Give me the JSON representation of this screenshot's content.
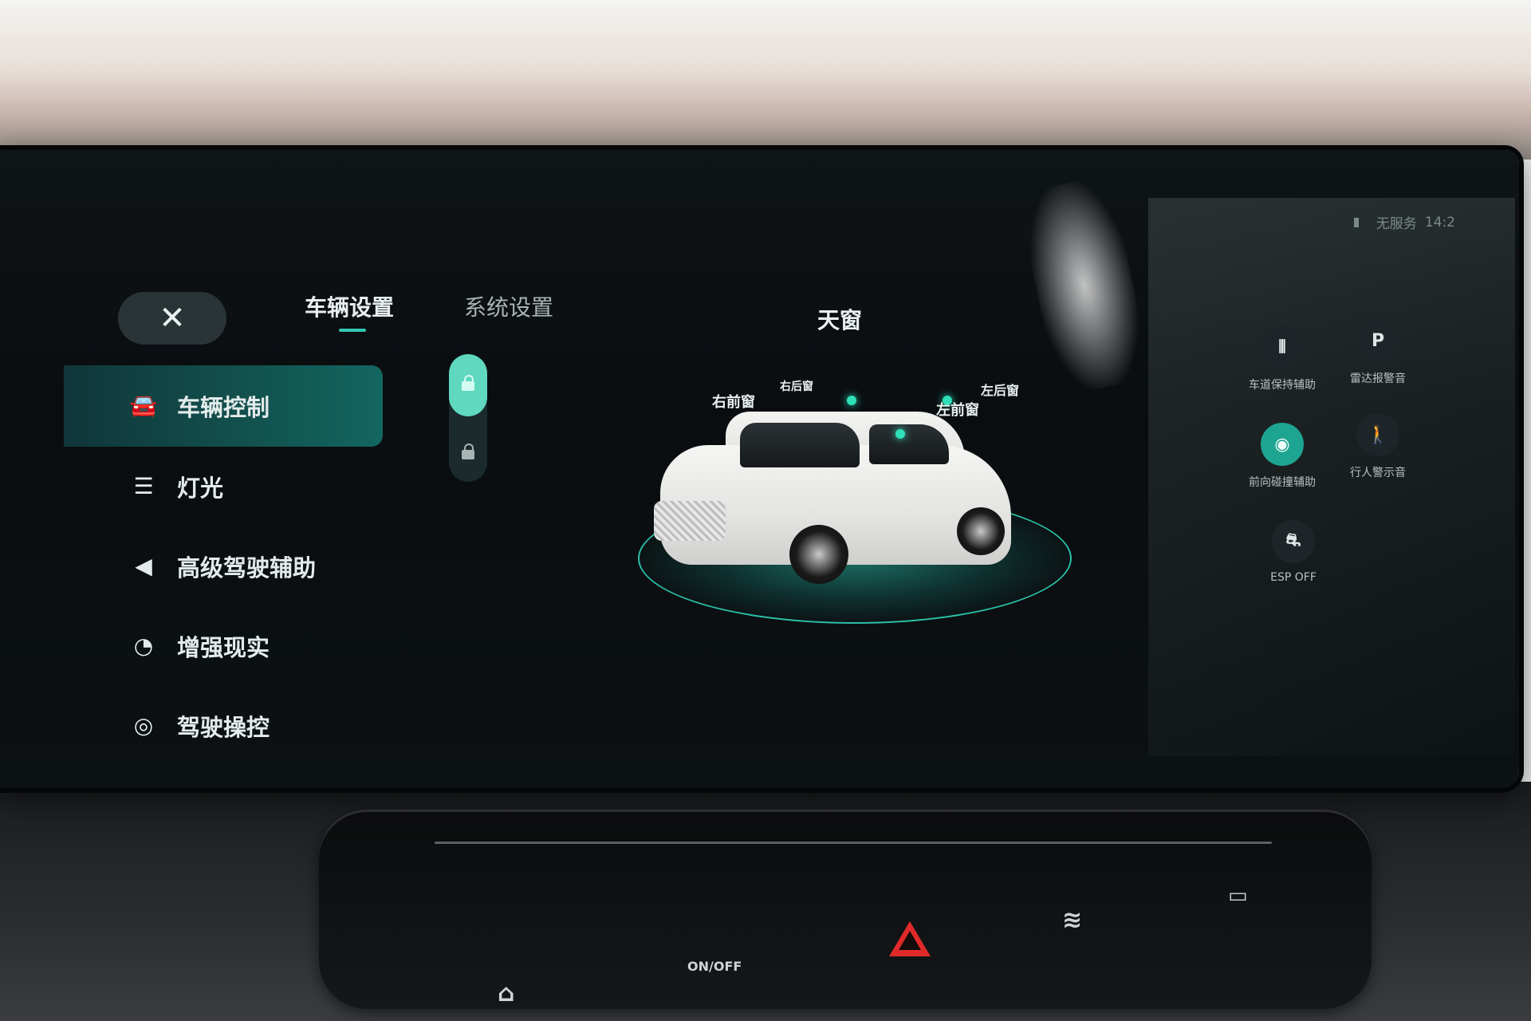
{
  "status_bar": {
    "network": "无服务",
    "time": "14:2"
  },
  "top_tabs": {
    "close_glyph": "✕",
    "active": "车辆设置",
    "inactive": "系统设置"
  },
  "sidebar": {
    "items": [
      {
        "label": "车辆控制",
        "icon": "car-icon",
        "active": true
      },
      {
        "label": "灯光",
        "icon": "headlight-icon",
        "active": false
      },
      {
        "label": "高级驾驶辅助",
        "icon": "driver-assist-icon",
        "active": false
      },
      {
        "label": "增强现实",
        "icon": "ar-icon",
        "active": false
      },
      {
        "label": "驾驶操控",
        "icon": "steering-wheel-icon",
        "active": false
      }
    ]
  },
  "door_lock": {
    "state": "unlocked"
  },
  "car_view": {
    "title": "天窗",
    "labels": [
      "右前窗",
      "右后窗",
      "左前窗",
      "左后窗"
    ]
  },
  "quick_functions": [
    {
      "label": "车道保持辅助",
      "icon": "lane-keep-icon",
      "active": false
    },
    {
      "label": "雷达报警音",
      "icon": "radar-alarm-icon",
      "active": false
    },
    {
      "label": "前向碰撞辅助",
      "icon": "forward-collision-icon",
      "active": true
    },
    {
      "label": "行人警示音",
      "icon": "pedestrian-alert-icon",
      "active": false
    },
    {
      "label": "ESP OFF",
      "icon": "esp-off-icon",
      "active": false
    }
  ],
  "hardware_buttons": [
    {
      "name": "home-icon",
      "glyph": "⌂"
    },
    {
      "name": "power-onoff-icon",
      "glyph": "ON/OFF"
    },
    {
      "name": "hazard-icon",
      "glyph": ""
    },
    {
      "name": "front-defrost-icon",
      "glyph": "≋"
    },
    {
      "name": "rear-defrost-icon",
      "glyph": "▭"
    }
  ],
  "colors": {
    "accent": "#31c6b1",
    "active_bg": "#136660",
    "hazard": "#e02a2a"
  }
}
